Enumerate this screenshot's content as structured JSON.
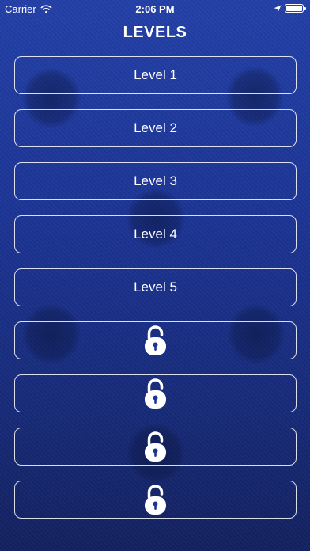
{
  "status_bar": {
    "carrier": "Carrier",
    "time": "2:06 PM",
    "battery_level": 1.0
  },
  "header": {
    "title": "LEVELS"
  },
  "levels": [
    {
      "label": "Level 1",
      "locked": false
    },
    {
      "label": "Level 2",
      "locked": false
    },
    {
      "label": "Level 3",
      "locked": false
    },
    {
      "label": "Level 4",
      "locked": false
    },
    {
      "label": "Level 5",
      "locked": false
    },
    {
      "label": "",
      "locked": true,
      "icon": "lock-icon"
    },
    {
      "label": "",
      "locked": true,
      "icon": "lock-icon"
    },
    {
      "label": "",
      "locked": true,
      "icon": "lock-icon"
    },
    {
      "label": "",
      "locked": true,
      "icon": "lock-icon"
    }
  ],
  "colors": {
    "background": "#1c3494",
    "text": "#ffffff",
    "button_border": "#ffffff"
  }
}
